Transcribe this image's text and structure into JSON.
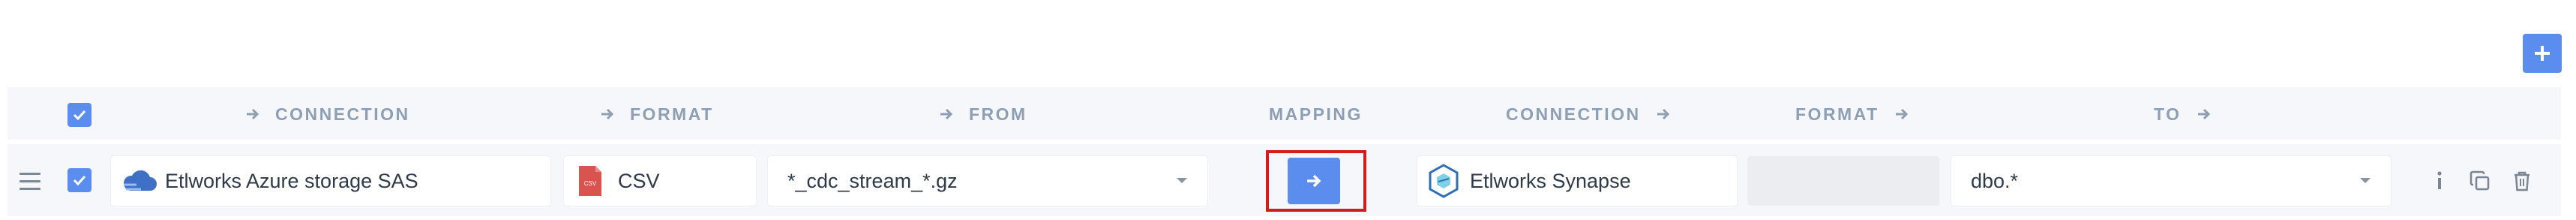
{
  "toolbar": {
    "add_icon": "plus-icon"
  },
  "header": {
    "select_all_checked": true,
    "columns": [
      {
        "label": "CONNECTION",
        "arrow": "left"
      },
      {
        "label": "FORMAT",
        "arrow": "left"
      },
      {
        "label": "FROM",
        "arrow": "left"
      },
      {
        "label": "MAPPING",
        "arrow": "none"
      },
      {
        "label": "CONNECTION",
        "arrow": "right"
      },
      {
        "label": "FORMAT",
        "arrow": "right"
      },
      {
        "label": "TO",
        "arrow": "right"
      }
    ]
  },
  "row": {
    "checked": true,
    "source_connection": {
      "value": "Etlworks Azure storage SAS",
      "icon": "azure-cloud-icon"
    },
    "source_format": {
      "value": "CSV",
      "icon": "csv-file-icon",
      "icon_text": "CSV"
    },
    "from": {
      "value": "*_cdc_stream_*.gz"
    },
    "mapping": {
      "icon": "arrow-right-icon"
    },
    "dest_connection": {
      "value": "Etlworks Synapse",
      "icon": "synapse-icon"
    },
    "dest_format": {
      "value": ""
    },
    "to": {
      "value": "dbo.*"
    },
    "actions": [
      "info-icon",
      "copy-icon",
      "trash-icon"
    ]
  },
  "colors": {
    "accent": "#5b8def",
    "header_text": "#8e9fb4",
    "highlight": "#d31d1d",
    "band": "#f5f7fa"
  }
}
